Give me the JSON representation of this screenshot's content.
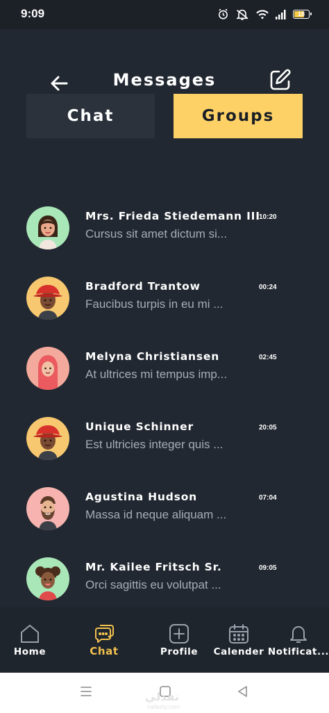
{
  "status_bar": {
    "time": "9:09",
    "battery": "18"
  },
  "header": {
    "title": "Messages"
  },
  "tabs": [
    {
      "label": "Chat",
      "active": false
    },
    {
      "label": "Groups",
      "active": true
    }
  ],
  "chats": [
    {
      "name": "Mrs. Frieda Stiedemann III",
      "time": "10:20",
      "preview": "Cursus sit amet dictum si...",
      "avatar_bg": "#a9e7b9",
      "avatar_icon": "woman-avatar-icon"
    },
    {
      "name": "Bradford Trantow",
      "time": "00:24",
      "preview": "Faucibus turpis in eu mi ...",
      "avatar_bg": "#f7c86f",
      "avatar_icon": "red-hat-avatar-icon"
    },
    {
      "name": "Melyna Christiansen",
      "time": "02:45",
      "preview": "At ultrices mi tempus imp...",
      "avatar_bg": "#f3a99c",
      "avatar_icon": "hijab-avatar-icon"
    },
    {
      "name": "Unique Schinner",
      "time": "20:05",
      "preview": "Est ultricies integer quis ...",
      "avatar_bg": "#f7c86f",
      "avatar_icon": "red-hat-avatar-icon"
    },
    {
      "name": "Agustina Hudson",
      "time": "07:04",
      "preview": "Massa id neque aliquam ...",
      "avatar_bg": "#f6b3b0",
      "avatar_icon": "bearded-man-avatar-icon"
    },
    {
      "name": "Mr. Kailee Fritsch Sr.",
      "time": "09:05",
      "preview": "Orci sagittis eu volutpat ...",
      "avatar_bg": "#a9e7b9",
      "avatar_icon": "curly-hair-avatar-icon"
    }
  ],
  "bottom_nav": [
    {
      "label": "Home",
      "icon": "home-icon",
      "active": false
    },
    {
      "label": "Chat",
      "icon": "chat-icon",
      "active": true
    },
    {
      "label": "Profile",
      "icon": "plus-square-icon",
      "active": false
    },
    {
      "label": "Calender",
      "icon": "calendar-icon",
      "active": false
    },
    {
      "label": "Notificat...",
      "icon": "bell-icon",
      "active": false
    }
  ],
  "watermark": {
    "text": "نفذلي",
    "sub": "nafezly.com"
  },
  "colors": {
    "background": "#222831",
    "accent": "#fdd166",
    "active_nav": "#f2c14e",
    "tab_inactive": "#2b323c",
    "preview_text": "#a7adb7"
  }
}
